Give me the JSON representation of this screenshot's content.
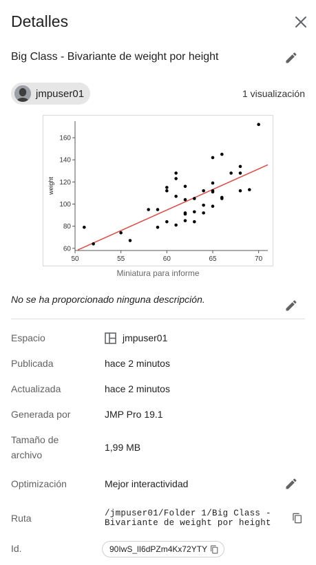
{
  "header": {
    "title": "Detalles"
  },
  "report": {
    "title": "Big Class - Bivariante de weight por height"
  },
  "owner": {
    "name": "jmpuser01"
  },
  "views_label": "1 visualización",
  "thumbnail": {
    "caption": "Miniatura para informe"
  },
  "description": "No se ha proporcionado ninguna descripción.",
  "properties": {
    "space": {
      "label": "Espacio",
      "value": "jmpuser01"
    },
    "published": {
      "label": "Publicada",
      "value": "hace 2 minutos"
    },
    "updated": {
      "label": "Actualizada",
      "value": "hace 2 minutos"
    },
    "generated_by": {
      "label": "Generada por",
      "value": "JMP Pro 19.1"
    },
    "file_size": {
      "label": "Tamaño de archivo",
      "value": "1,99 MB"
    },
    "optimization": {
      "label": "Optimización",
      "value": "Mejor interactividad"
    },
    "path": {
      "label": "Ruta",
      "line1": "/jmpuser01/Folder 1/Big Class -",
      "line2": "Bivariante de weight por height"
    },
    "id": {
      "label": "Id.",
      "value": "90IwS_lI6dPZm4Kx72YTY"
    }
  },
  "icons": {
    "close": "close-icon",
    "edit": "pencil-icon",
    "space": "space-layout-icon",
    "copy": "copy-icon",
    "avatar": "user-avatar-icon"
  },
  "colors": {
    "fit_line": "#d9534f",
    "points": "#000000",
    "accent_text": "#212121"
  },
  "chart_data": {
    "type": "scatter",
    "xlabel": "",
    "ylabel": "weight",
    "xlim": [
      50,
      71
    ],
    "ylim": [
      58,
      175
    ],
    "x_ticks": [
      50,
      55,
      60,
      65,
      70
    ],
    "y_ticks": [
      60,
      80,
      100,
      120,
      140,
      160
    ],
    "points": [
      [
        51,
        79
      ],
      [
        52,
        64
      ],
      [
        55,
        74
      ],
      [
        56,
        67
      ],
      [
        58,
        95
      ],
      [
        59,
        95
      ],
      [
        59,
        79
      ],
      [
        60,
        84
      ],
      [
        60,
        112
      ],
      [
        60,
        115
      ],
      [
        61,
        81
      ],
      [
        61,
        107
      ],
      [
        61,
        123
      ],
      [
        61,
        128
      ],
      [
        62,
        85
      ],
      [
        62,
        91
      ],
      [
        62,
        92
      ],
      [
        62,
        104
      ],
      [
        62,
        116
      ],
      [
        63,
        84
      ],
      [
        63,
        93
      ],
      [
        63,
        105
      ],
      [
        64,
        92
      ],
      [
        64,
        99
      ],
      [
        64,
        112
      ],
      [
        65,
        98
      ],
      [
        65,
        111
      ],
      [
        65,
        112
      ],
      [
        65,
        119
      ],
      [
        65,
        142
      ],
      [
        66,
        105
      ],
      [
        66,
        106
      ],
      [
        66,
        145
      ],
      [
        67,
        128
      ],
      [
        68,
        112
      ],
      [
        68,
        128
      ],
      [
        68,
        134
      ],
      [
        69,
        113
      ],
      [
        70,
        172
      ]
    ],
    "fit_line": [
      [
        50.3,
        58.5
      ],
      [
        71,
        135.5
      ]
    ]
  }
}
